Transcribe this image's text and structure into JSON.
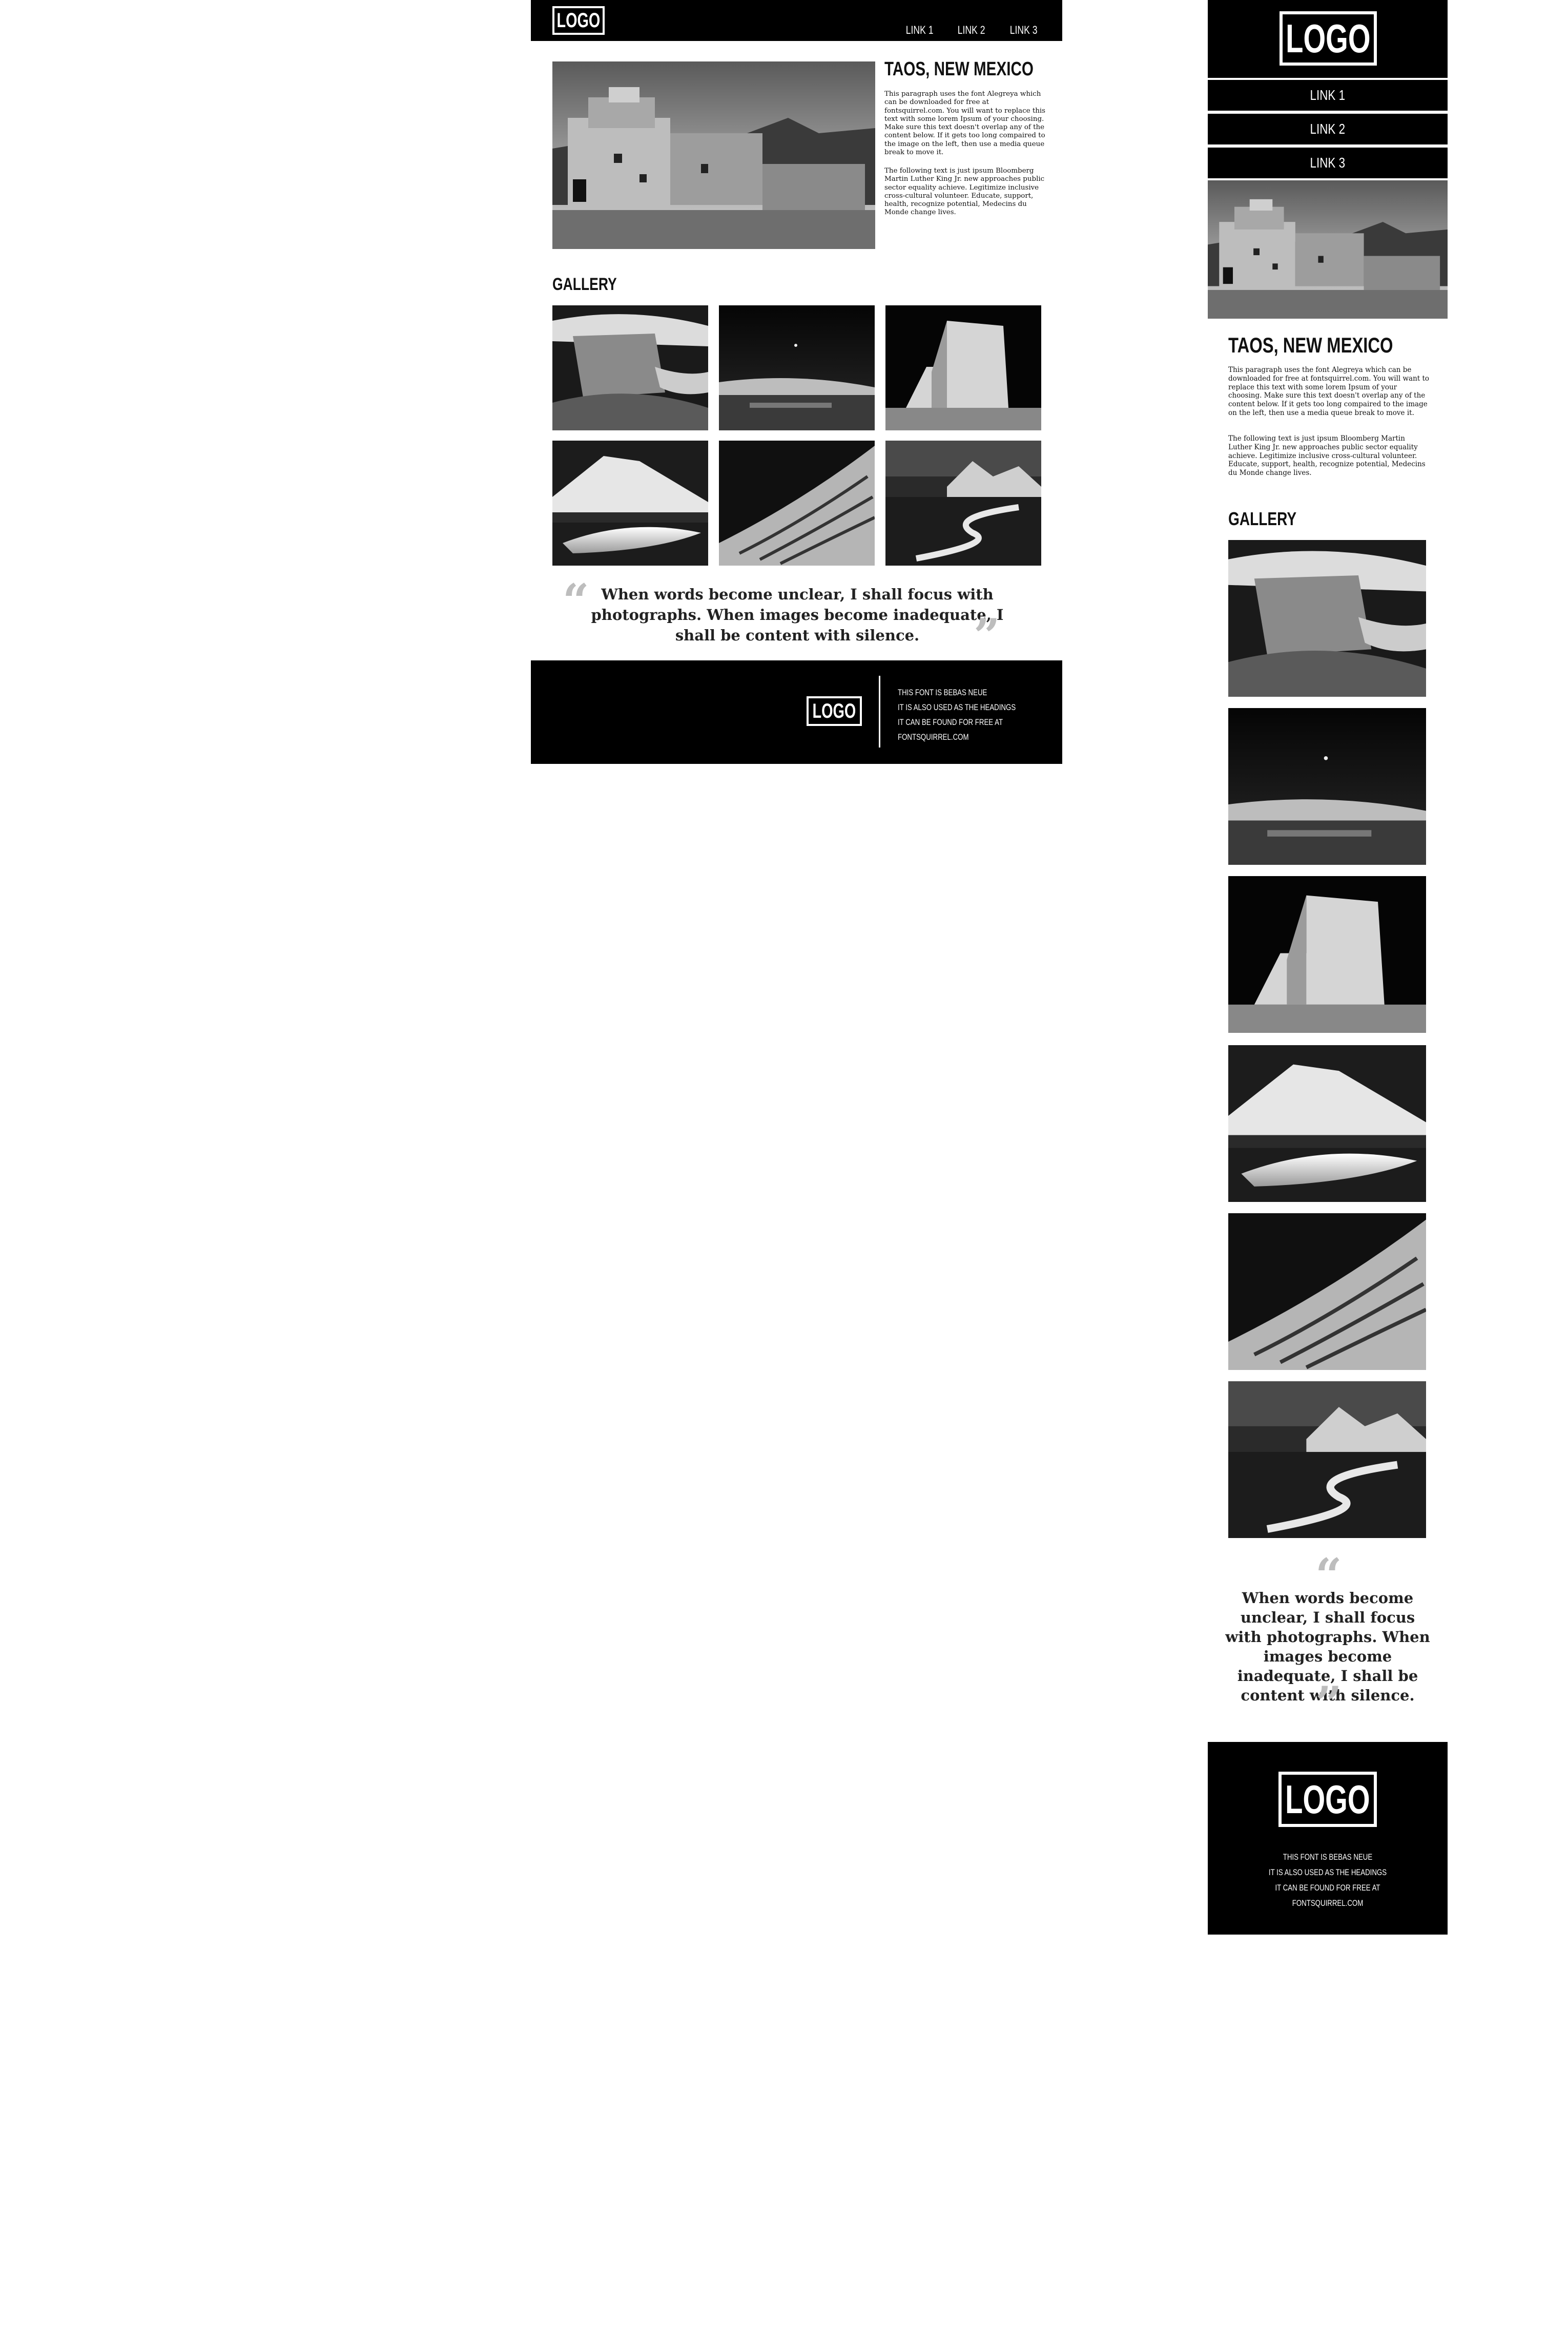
{
  "site": {
    "logo": "LOGO",
    "nav": [
      "LINK 1",
      "LINK 2",
      "LINK 3"
    ]
  },
  "article": {
    "title": "TAOS, NEW MEXICO",
    "desktop_paragraphs": [
      "This paragraph uses the font Alegreya which can be downloaded for free at fontsquirrel.com. You will want to replace this text with some lorem Ipsum of your choosing. Make sure this text doesn't overlap any of the content below. If it gets too long compaired to the image on the left, then use a media queue break to move it.",
      "The following text is just ipsum Bloomberg Martin Luther King Jr. new approaches public sector equality achieve. Legitimize inclusive cross-cultural volunteer. Educate, support, health, recognize potential, Medecins du Monde change lives."
    ],
    "mobile_paragraphs": [
      "This paragraph uses the font Alegreya which can be downloaded for free at fontsquirrel.com. You will want to replace this text with some lorem Ipsum of your choosing. Make sure this text doesn't overlap any of the content below. If it gets too long compaired to the image on the left, then use a media queue break to move it.",
      "The following text is just ipsum Bloomberg Martin Luther King Jr. new approaches public sector equality achieve. Legitimize inclusive cross-cultural volunteer. Educate, support, health, recognize potential, Medecins du Monde change lives."
    ],
    "hero_image": "pueblo-photo"
  },
  "gallery": {
    "heading": "GALLERY",
    "images": [
      "canyon-photo",
      "night-sky-photo",
      "adobe-church-photo",
      "mountain-lake-photo",
      "sand-dune-photo",
      "river-mountains-photo"
    ]
  },
  "quote": {
    "open_mark": "“",
    "close_mark": "”",
    "text": "When words become unclear, I shall focus with photographs. When images become inadequate, I shall be content with silence."
  },
  "footer": {
    "logo": "LOGO",
    "lines": [
      "THIS FONT IS BEBAS NEUE",
      "IT IS ALSO USED AS THE HEADINGS",
      "IT CAN BE FOUND FOR FREE AT",
      "FONTSQUIRREL.COM"
    ]
  },
  "colors": {
    "background": "#ffffff",
    "bars": "#000000",
    "quote_marks": "#bdbdbd"
  }
}
